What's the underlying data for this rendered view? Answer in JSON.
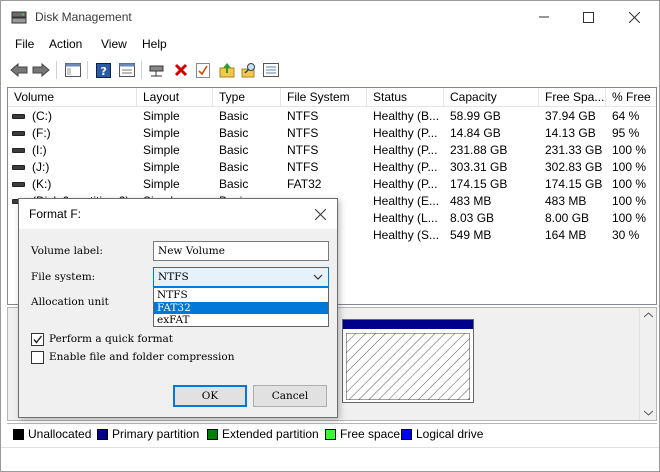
{
  "window": {
    "title": "Disk Management"
  },
  "menu": [
    "File",
    "Action",
    "View",
    "Help"
  ],
  "toolbar_icons": [
    "back-arrow-icon",
    "forward-arrow-icon",
    "console-tree-icon",
    "help-icon",
    "properties-icon",
    "connect-icon",
    "delete-icon",
    "checklist-icon",
    "up-folder-icon",
    "search-icon",
    "list-view-icon"
  ],
  "columns": [
    "Volume",
    "Layout",
    "Type",
    "File System",
    "Status",
    "Capacity",
    "Free Spa...",
    "% Free"
  ],
  "volumes": [
    {
      "volume": "(C:)",
      "layout": "Simple",
      "type": "Basic",
      "fs": "NTFS",
      "status": "Healthy (B...",
      "capacity": "58.99 GB",
      "free": "37.94 GB",
      "pct": "64 %"
    },
    {
      "volume": "(F:)",
      "layout": "Simple",
      "type": "Basic",
      "fs": "NTFS",
      "status": "Healthy (P...",
      "capacity": "14.84 GB",
      "free": "14.13 GB",
      "pct": "95 %"
    },
    {
      "volume": "(I:)",
      "layout": "Simple",
      "type": "Basic",
      "fs": "NTFS",
      "status": "Healthy (P...",
      "capacity": "231.88 GB",
      "free": "231.33 GB",
      "pct": "100 %"
    },
    {
      "volume": "(J:)",
      "layout": "Simple",
      "type": "Basic",
      "fs": "NTFS",
      "status": "Healthy (P...",
      "capacity": "303.31 GB",
      "free": "302.83 GB",
      "pct": "100 %"
    },
    {
      "volume": "(K:)",
      "layout": "Simple",
      "type": "Basic",
      "fs": "FAT32",
      "status": "Healthy (P...",
      "capacity": "174.15 GB",
      "free": "174.15 GB",
      "pct": "100 %"
    },
    {
      "volume": "(Disk 0 partition 2)",
      "layout": "Simple",
      "type": "Basic",
      "fs": "",
      "status": "Healthy (E...",
      "capacity": "483 MB",
      "free": "483 MB",
      "pct": "100 %"
    },
    {
      "volume": "",
      "layout": "",
      "type": "",
      "fs": "",
      "status": "Healthy (L...",
      "capacity": "8.03 GB",
      "free": "8.00 GB",
      "pct": "100 %"
    },
    {
      "volume": "",
      "layout": "",
      "type": "",
      "fs": "",
      "status": "Healthy (S...",
      "capacity": "549 MB",
      "free": "164 MB",
      "pct": "30 %"
    }
  ],
  "legend": [
    {
      "label": "Unallocated",
      "color": "#000000"
    },
    {
      "label": "Primary partition",
      "color": "#00008b"
    },
    {
      "label": "Extended partition",
      "color": "#008000"
    },
    {
      "label": "Free space",
      "color": "#33ff33"
    },
    {
      "label": "Logical drive",
      "color": "#0000ff"
    }
  ],
  "dialog": {
    "title": "Format F:",
    "volume_label_caption": "Volume label:",
    "volume_label_value": "New Volume",
    "file_system_caption": "File system:",
    "file_system_value": "NTFS",
    "file_system_options": [
      "NTFS",
      "FAT32",
      "exFAT"
    ],
    "file_system_highlighted": "FAT32",
    "allocation_unit_caption": "Allocation unit",
    "quick_format_label": "Perform a quick format",
    "quick_format_checked": true,
    "compression_label": "Enable file and folder compression",
    "compression_checked": false,
    "ok_label": "OK",
    "cancel_label": "Cancel"
  },
  "graph_partial_text": [
    "R",
    "5",
    "O"
  ]
}
